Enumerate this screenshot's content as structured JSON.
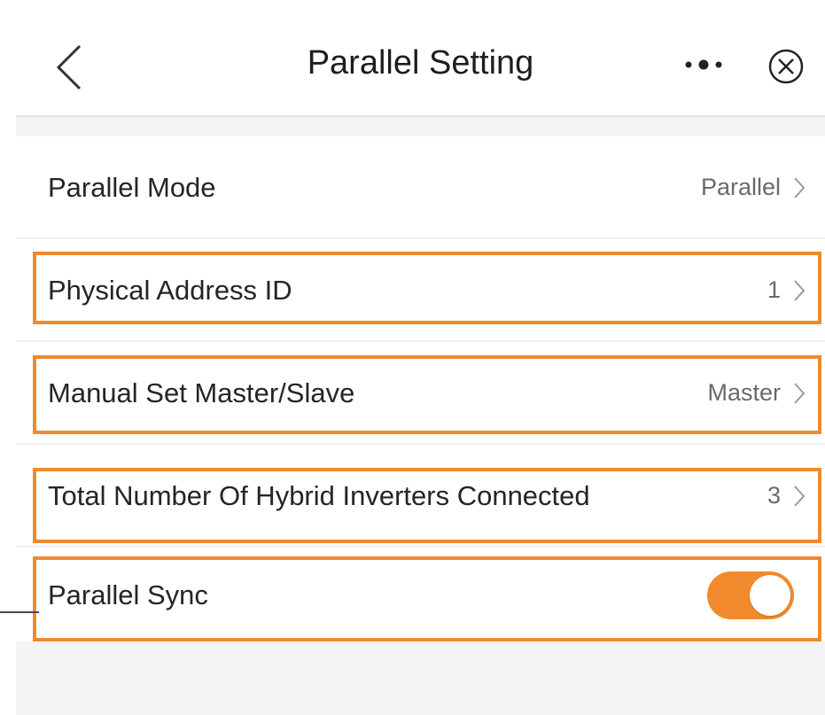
{
  "header": {
    "title": "Parallel Setting",
    "back_icon": "chevron-left-icon",
    "more_icon": "more-dots-icon",
    "close_icon": "close-circle-icon"
  },
  "settings": [
    {
      "label": "Parallel Mode",
      "value": "Parallel"
    },
    {
      "label": "Physical Address ID",
      "value": "1"
    },
    {
      "label": "Manual Set Master/Slave",
      "value": "Master"
    },
    {
      "label": "Total Number Of Hybrid Inverters Connected",
      "value": "3"
    },
    {
      "label": "Parallel Sync",
      "toggle_on": true
    }
  ],
  "colors": {
    "highlight": "#f08a2c",
    "toggle_on": "#f08a2c"
  }
}
